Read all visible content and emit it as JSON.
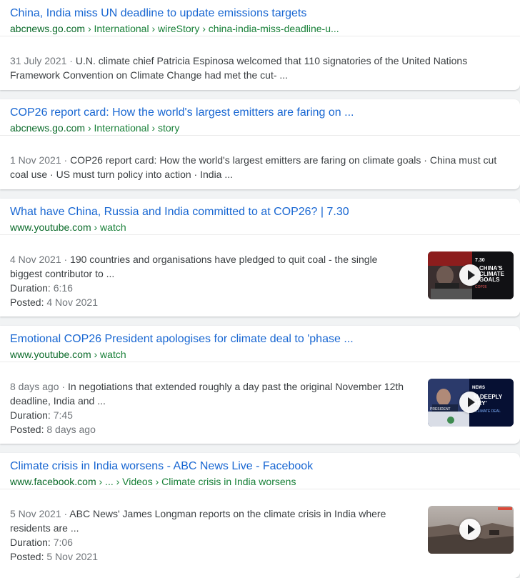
{
  "results": [
    {
      "title": "China, India miss UN deadline to update emissions targets",
      "domain": "abcnews.go.com",
      "path": " › International › wireStory › china-india-miss-deadline-u...",
      "date": "31 July 2021",
      "snippet": "U.N. climate chief Patricia Espinosa welcomed that 110 signatories of the United Nations Framework Convention on Climate Change had met the cut- ..."
    },
    {
      "title": "COP26 report card: How the world's largest emitters are faring on ...",
      "domain": "abcnews.go.com",
      "path": " › International › story",
      "date": "1 Nov 2021",
      "snippet": "COP26 report card: How the world's largest emitters are faring on climate goals · China must cut coal use · US must turn policy into action · India ..."
    },
    {
      "title": "What have China, Russia and India committed to at COP26? | 7.30",
      "domain": "www.youtube.com",
      "path": " › watch",
      "date": "4 Nov 2021",
      "snippet": "190 countries and organisations have pledged to quit coal - the single biggest contributor to ...",
      "duration_label": "Duration:",
      "duration": "6:16",
      "posted_label": "Posted:",
      "posted": "4 Nov 2021",
      "thumb_text": [
        "CHINA'S",
        "CLIMATE",
        "GOALS"
      ],
      "thumb_tag": "COP26",
      "thumb_brand": "7.30"
    },
    {
      "title": "Emotional COP26 President apologises for climate deal to 'phase ...",
      "domain": "www.youtube.com",
      "path": " › watch",
      "date": "8 days ago",
      "snippet": "In negotiations that extended roughly a day past the original November 12th deadline, India and ...",
      "duration_label": "Duration:",
      "duration": "7:45",
      "posted_label": "Posted:",
      "posted": "8 days ago",
      "thumb_text": [
        "M DEEPLY",
        "RRY'"
      ],
      "thumb_tag": "CLIMATE DEAL",
      "thumb_brand": "NEWS",
      "thumb_caption": "PRESIDENT"
    },
    {
      "title": "Climate crisis in India worsens - ABC News Live - Facebook",
      "domain": "www.facebook.com",
      "path": " › ... › Videos › Climate crisis in India worsens",
      "date": "5 Nov 2021",
      "snippet": "ABC News' James Longman reports on the climate crisis in India where residents are ...",
      "duration_label": "Duration:",
      "duration": "7:06",
      "posted_label": "Posted:",
      "posted": "5 Nov 2021"
    }
  ],
  "separator": " · ",
  "colors": {
    "link": "#1967d2",
    "url": "#188038",
    "text": "#3c4043",
    "muted": "#70757a"
  }
}
